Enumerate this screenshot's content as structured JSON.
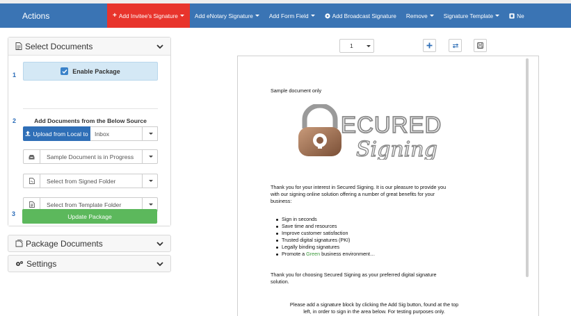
{
  "topbar": {
    "actions_label": "Actions",
    "menus": [
      {
        "label": "Add Invitee's Signature",
        "active": true,
        "prefix": "+",
        "caret": true
      },
      {
        "label": "Add eNotary Signature",
        "active": false,
        "caret": true
      },
      {
        "label": "Add Form Field",
        "active": false,
        "caret": true
      },
      {
        "label": "Add Broadcast Signature",
        "active": false,
        "icon": "broadcast-icon",
        "caret": false
      },
      {
        "label": "Remove",
        "active": false,
        "caret": true
      },
      {
        "label": "Signature Template",
        "active": false,
        "caret": true
      },
      {
        "label": "Ne",
        "active": false,
        "icon": "new-icon",
        "caret": false
      }
    ],
    "colors": {
      "bar": "#3a74b4",
      "active": "#e8342c"
    }
  },
  "sidebar": {
    "select_documents": {
      "title": "Select Documents",
      "step1": {
        "num": "1",
        "enable_label": "Enable Package",
        "checked": true
      },
      "step2": {
        "num": "2",
        "title": "Add Documents from the Below Source",
        "upload_label": "Upload from Local to",
        "upload_target": "Inbox",
        "sources": [
          {
            "icon": "inbox-icon",
            "label": "Sample Document is in Progress"
          },
          {
            "icon": "signed-file-icon",
            "label": "Select from Signed Folder"
          },
          {
            "icon": "template-file-icon",
            "label": "Select from Template Folder"
          }
        ]
      },
      "step3": {
        "num": "3",
        "update_label": "Update Package"
      }
    },
    "package_documents": {
      "title": "Package Documents"
    },
    "settings": {
      "title": "Settings"
    }
  },
  "doc_toolbar": {
    "page": "1"
  },
  "document": {
    "heading": "Sample document only",
    "logo_top": "ECURED",
    "logo_bottom": "Signing",
    "intro_lines": [
      "Thank you for your interest in Secured Signing. It is our pleasure to provide you",
      "with our signing online solution offering a number of great benefits for your",
      "business:"
    ],
    "benefits": [
      "Sign in seconds",
      "Save time and resources",
      "Improve customer satisfaction",
      "Trusted digital signatures (PKI)",
      "Legally binding signatures"
    ],
    "benefit_last_pre": "Promote a ",
    "benefit_last_green": "Green",
    "benefit_last_post": " business environment…",
    "thanks_lines": [
      "Thank you for choosing Secured Signing as your preferred digital signature",
      "solution."
    ],
    "instruction_lines": [
      "Please add a signature block by clicking the Add Sig button, found at the top",
      "left, in order to sign in the area below. For testing purposes only."
    ]
  }
}
